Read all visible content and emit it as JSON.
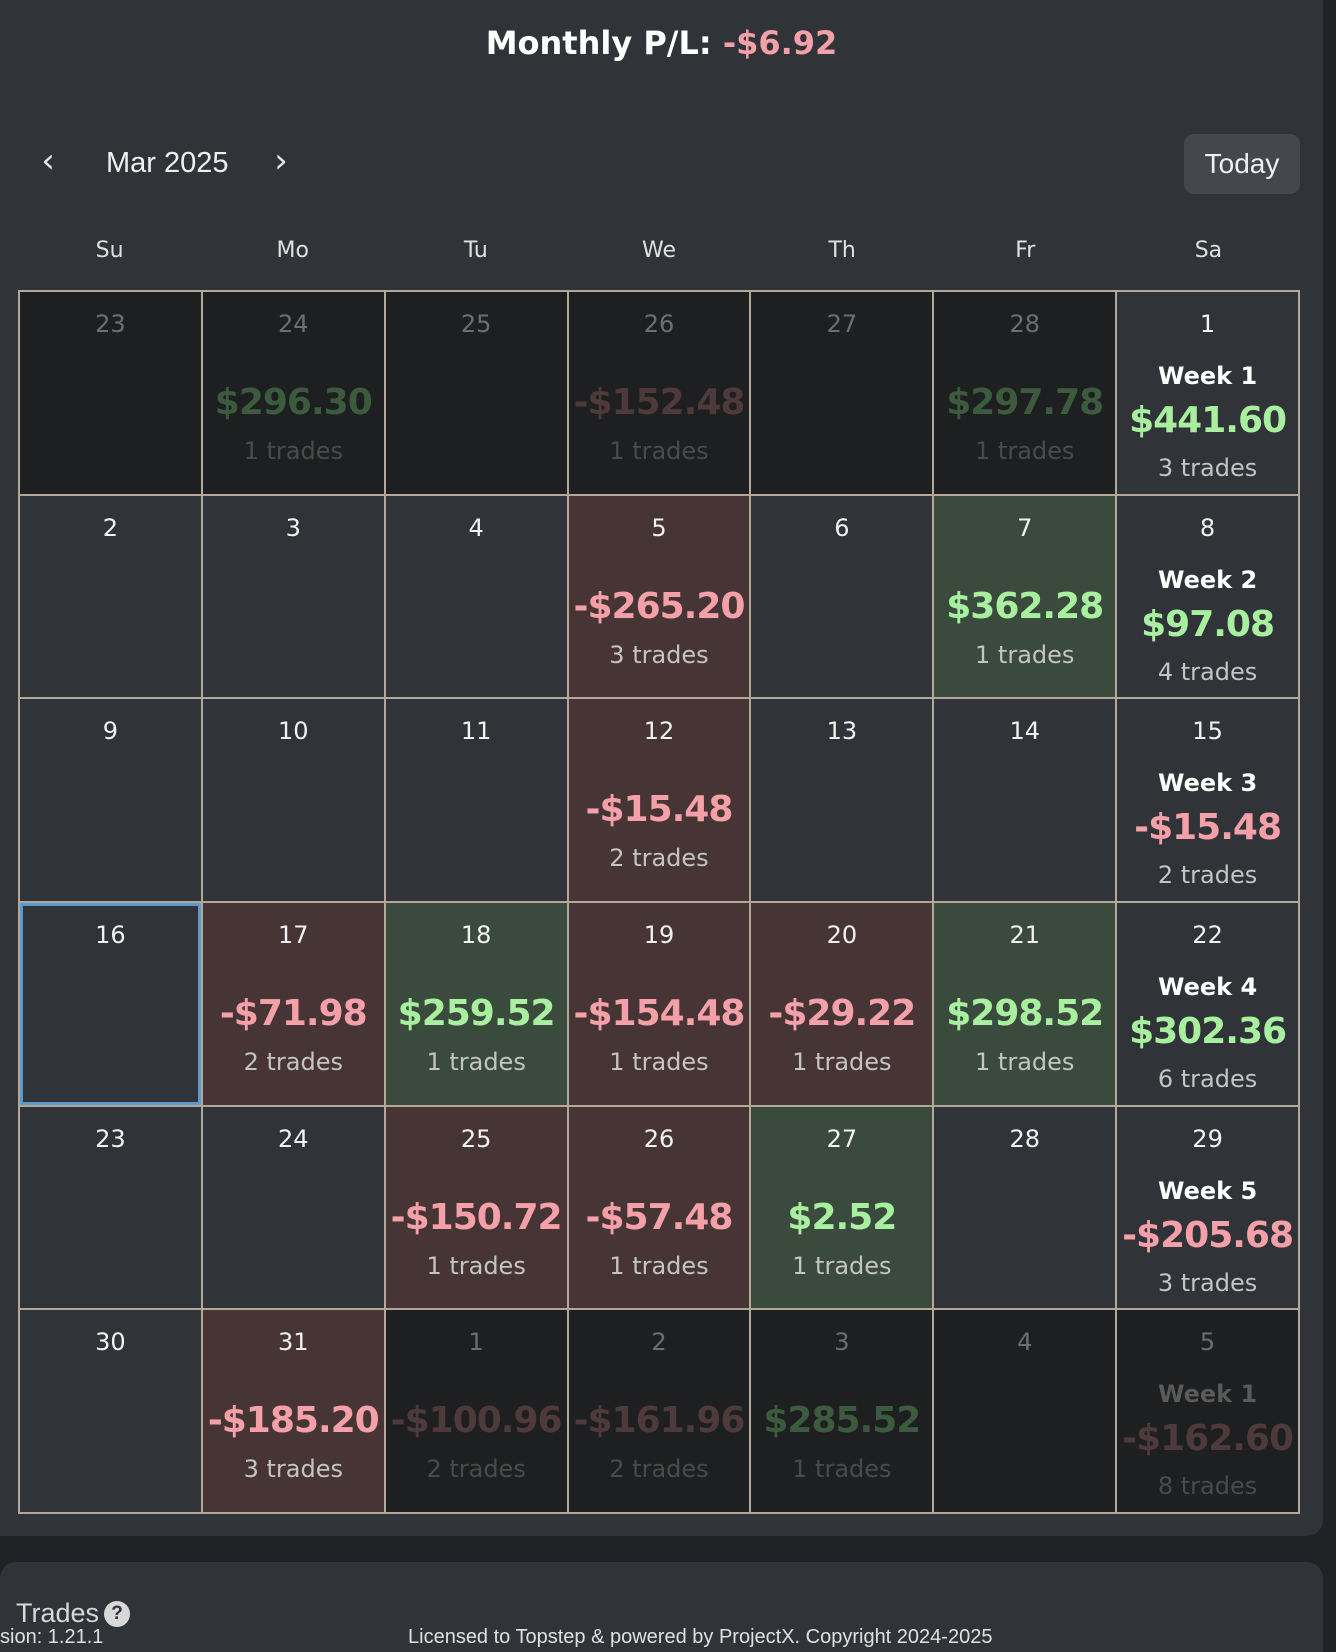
{
  "header": {
    "title_label": "Monthly P/L:",
    "title_value": "-$6.92"
  },
  "nav": {
    "prev_icon": "chevron-left-icon",
    "prev_glyph": "‹",
    "next_icon": "chevron-right-icon",
    "next_glyph": "›",
    "month_label": "Mar 2025",
    "today_label": "Today"
  },
  "colors": {
    "positive_text": "#a8f0a0",
    "negative_text": "#f4a0a8",
    "positive_cell": "#3a4a3c",
    "negative_cell": "#473536",
    "selected_border": "#5b9ad0"
  },
  "weekdays": [
    "Su",
    "Mo",
    "Tu",
    "We",
    "Th",
    "Fr",
    "Sa"
  ],
  "weeks": [
    [
      {
        "day": "23",
        "other": true
      },
      {
        "day": "24",
        "other": true,
        "amount": "$296.30",
        "trades": "1 trades",
        "sign": "pos"
      },
      {
        "day": "25",
        "other": true
      },
      {
        "day": "26",
        "other": true,
        "amount": "-$152.48",
        "trades": "1 trades",
        "sign": "neg"
      },
      {
        "day": "27",
        "other": true
      },
      {
        "day": "28",
        "other": true,
        "amount": "$297.78",
        "trades": "1 trades",
        "sign": "pos"
      },
      {
        "day": "1",
        "week_label": "Week 1",
        "amount": "$441.60",
        "trades": "3 trades",
        "sign": "pos"
      }
    ],
    [
      {
        "day": "2"
      },
      {
        "day": "3"
      },
      {
        "day": "4"
      },
      {
        "day": "5",
        "amount": "-$265.20",
        "trades": "3 trades",
        "sign": "neg"
      },
      {
        "day": "6"
      },
      {
        "day": "7",
        "amount": "$362.28",
        "trades": "1 trades",
        "sign": "pos"
      },
      {
        "day": "8",
        "week_label": "Week 2",
        "amount": "$97.08",
        "trades": "4 trades",
        "sign": "pos"
      }
    ],
    [
      {
        "day": "9"
      },
      {
        "day": "10"
      },
      {
        "day": "11"
      },
      {
        "day": "12",
        "amount": "-$15.48",
        "trades": "2 trades",
        "sign": "neg"
      },
      {
        "day": "13"
      },
      {
        "day": "14"
      },
      {
        "day": "15",
        "week_label": "Week 3",
        "amount": "-$15.48",
        "trades": "2 trades",
        "sign": "neg"
      }
    ],
    [
      {
        "day": "16",
        "selected": true
      },
      {
        "day": "17",
        "amount": "-$71.98",
        "trades": "2 trades",
        "sign": "neg"
      },
      {
        "day": "18",
        "amount": "$259.52",
        "trades": "1 trades",
        "sign": "pos"
      },
      {
        "day": "19",
        "amount": "-$154.48",
        "trades": "1 trades",
        "sign": "neg"
      },
      {
        "day": "20",
        "amount": "-$29.22",
        "trades": "1 trades",
        "sign": "neg"
      },
      {
        "day": "21",
        "amount": "$298.52",
        "trades": "1 trades",
        "sign": "pos"
      },
      {
        "day": "22",
        "week_label": "Week 4",
        "amount": "$302.36",
        "trades": "6 trades",
        "sign": "pos"
      }
    ],
    [
      {
        "day": "23"
      },
      {
        "day": "24"
      },
      {
        "day": "25",
        "amount": "-$150.72",
        "trades": "1 trades",
        "sign": "neg"
      },
      {
        "day": "26",
        "amount": "-$57.48",
        "trades": "1 trades",
        "sign": "neg"
      },
      {
        "day": "27",
        "amount": "$2.52",
        "trades": "1 trades",
        "sign": "pos"
      },
      {
        "day": "28"
      },
      {
        "day": "29",
        "week_label": "Week 5",
        "amount": "-$205.68",
        "trades": "3 trades",
        "sign": "neg"
      }
    ],
    [
      {
        "day": "30"
      },
      {
        "day": "31",
        "amount": "-$185.20",
        "trades": "3 trades",
        "sign": "neg"
      },
      {
        "day": "1",
        "other": true,
        "amount": "-$100.96",
        "trades": "2 trades",
        "sign": "neg"
      },
      {
        "day": "2",
        "other": true,
        "amount": "-$161.96",
        "trades": "2 trades",
        "sign": "neg"
      },
      {
        "day": "3",
        "other": true,
        "amount": "$285.52",
        "trades": "1 trades",
        "sign": "pos"
      },
      {
        "day": "4",
        "other": true
      },
      {
        "day": "5",
        "other": true,
        "week_label": "Week 1",
        "amount": "-$162.60",
        "trades": "8 trades",
        "sign": "neg"
      }
    ]
  ],
  "trades_section": {
    "title": "Trades",
    "help_icon": "question-circle-icon",
    "help_glyph": "?"
  },
  "footer": {
    "version": "sion: 1.21.1",
    "license": "Licensed to Topstep & powered by ProjectX. Copyright 2024-2025"
  }
}
